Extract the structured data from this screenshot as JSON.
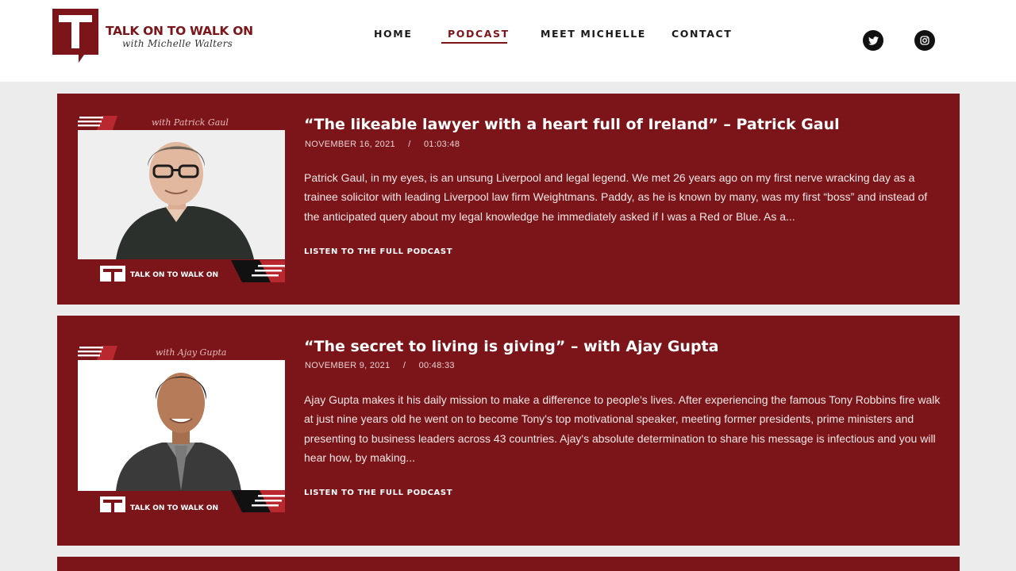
{
  "site": {
    "logo_title": "TALK ON TO WALK ON",
    "logo_subtitle": "with Michelle Walters",
    "brand_color": "#7b1519"
  },
  "nav": {
    "items": [
      {
        "label": "HOME",
        "active": false
      },
      {
        "label": "PODCAST",
        "active": true
      },
      {
        "label": "MEET MICHELLE",
        "active": false
      },
      {
        "label": "CONTACT",
        "active": false
      }
    ]
  },
  "social": [
    {
      "icon": "twitter-icon"
    },
    {
      "icon": "instagram-icon"
    }
  ],
  "episodes": [
    {
      "thumb_guest": "with Patrick Gaul",
      "thumb_brand": "TALK ON TO WALK ON",
      "title": "“The likeable lawyer with a heart full of Ireland” – Patrick Gaul",
      "date": "NOVEMBER 16, 2021",
      "separator": "/",
      "duration": "01:03:48",
      "excerpt": "Patrick Gaul, in my eyes, is an unsung Liverpool and legal legend. We met 26 years ago on my first nerve wracking day as a trainee solicitor with leading Liverpool law firm Weightmans. Paddy, as he is known by many, was my first “boss” and instead of the anticipated query about my legal knowledge he immediately asked if I was a Red or Blue. As a...",
      "cta": "LISTEN TO THE FULL PODCAST"
    },
    {
      "thumb_guest": "with Ajay Gupta",
      "thumb_brand": "TALK ON TO WALK ON",
      "title": "“The secret to living is giving” – with Ajay Gupta",
      "date": "NOVEMBER 9, 2021",
      "separator": "/",
      "duration": "00:48:33",
      "excerpt": "Ajay Gupta makes it his daily mission to make a difference to people's lives. After experiencing the famous Tony Robbins fire walk at just nine years old he went on to become Tony's top motivational speaker, meeting former presidents, prime ministers and presenting to business leaders across 43 countries. Ajay's absolute determination to share his message is infectious and you will hear how, by making...",
      "cta": "LISTEN TO THE FULL PODCAST"
    }
  ]
}
